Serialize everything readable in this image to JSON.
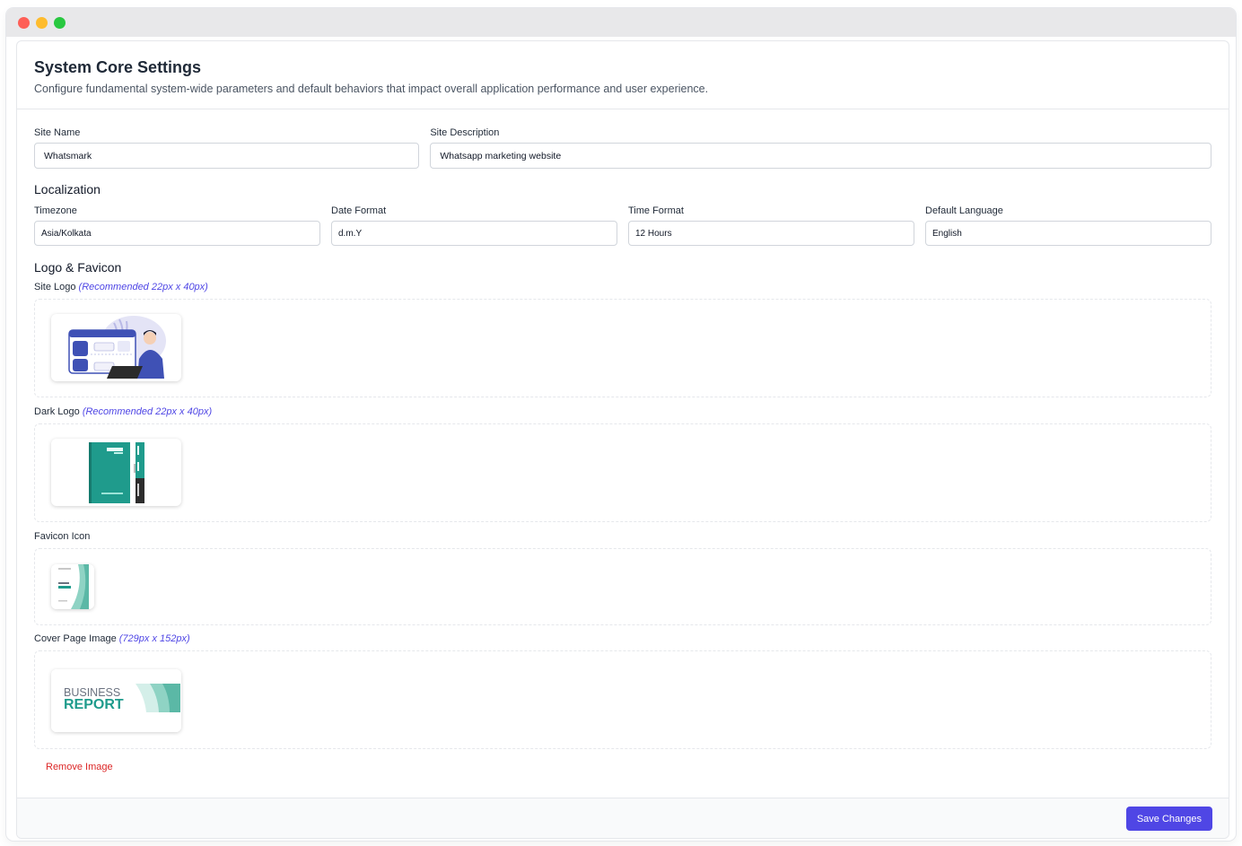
{
  "settings": {
    "title": "System Core Settings",
    "description": "Configure fundamental system-wide parameters and default behaviors that impact overall application performance and user experience."
  },
  "site": {
    "name_label": "Site Name",
    "name_value": "Whatsmark",
    "description_label": "Site Description",
    "description_value": "Whatsapp marketing website"
  },
  "localization": {
    "heading": "Localization",
    "timezone_label": "Timezone",
    "timezone_value": "Asia/Kolkata",
    "date_format_label": "Date Format",
    "date_format_value": "d.m.Y",
    "time_format_label": "Time Format",
    "time_format_value": "12 Hours",
    "language_label": "Default Language",
    "language_value": "English"
  },
  "logos": {
    "heading": "Logo & Favicon",
    "site_logo_label": "Site Logo",
    "site_logo_hint": "(Recommended 22px x 40px)",
    "dark_logo_label": "Dark Logo",
    "dark_logo_hint": "(Recommended 22px x 40px)",
    "favicon_label": "Favicon Icon",
    "cover_label": "Cover Page Image",
    "cover_hint": "(729px x 152px)",
    "cover_text_line1": "BUSINESS",
    "cover_text_line2": "REPORT",
    "remove_image": "Remove Image"
  },
  "footer": {
    "save_label": "Save Changes"
  },
  "colors": {
    "accent": "#4f46e5",
    "danger": "#dc2626",
    "teal": "#1f9b8c"
  }
}
